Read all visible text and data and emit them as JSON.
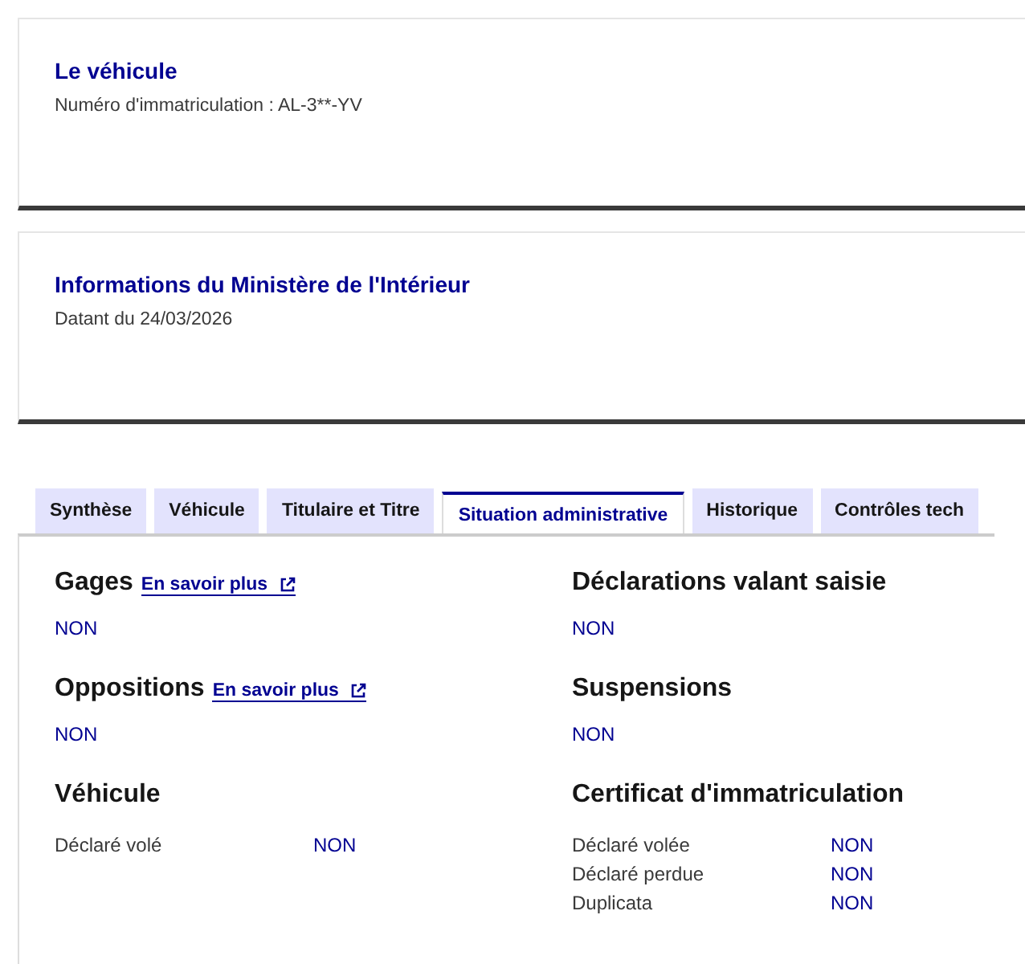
{
  "cards": [
    {
      "title": "Le véhicule",
      "text": "Numéro d'immatriculation : AL-3**-YV"
    },
    {
      "title": "Informations du Ministère de l'Intérieur",
      "text": "Datant du 24/03/2026"
    }
  ],
  "tabs": [
    {
      "label": "Synthèse",
      "selected": false
    },
    {
      "label": "Véhicule",
      "selected": false
    },
    {
      "label": "Titulaire et Titre",
      "selected": false
    },
    {
      "label": "Situation administrative",
      "selected": true
    },
    {
      "label": "Historique",
      "selected": false
    },
    {
      "label": "Contrôles tech",
      "selected": false
    }
  ],
  "sections": [
    {
      "kind": "value",
      "title": "Gages",
      "link": "En savoir plus",
      "value": "NON"
    },
    {
      "kind": "value",
      "title": "Déclarations valant saisie",
      "value": "NON"
    },
    {
      "kind": "value",
      "title": "Oppositions",
      "link": "En savoir plus",
      "value": "NON"
    },
    {
      "kind": "value",
      "title": "Suspensions",
      "value": "NON"
    },
    {
      "kind": "rows",
      "title": "Véhicule",
      "rows": [
        {
          "label": "Déclaré volé",
          "value": "NON"
        }
      ]
    },
    {
      "kind": "rows",
      "title": "Certificat d'immatriculation",
      "rows": [
        {
          "label": "Déclaré volée",
          "value": "NON"
        },
        {
          "label": "Déclaré perdue",
          "value": "NON"
        },
        {
          "label": "Duplicata",
          "value": "NON"
        }
      ]
    }
  ]
}
